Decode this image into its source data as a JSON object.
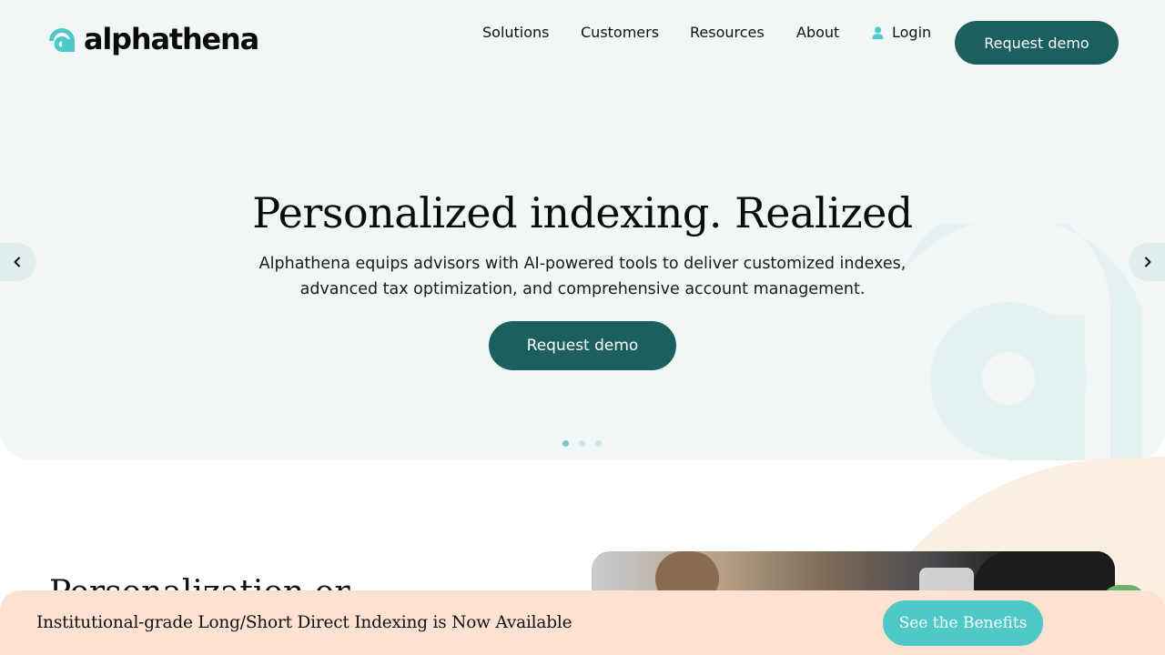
{
  "brand": {
    "name": "alphathena",
    "accent": "#1c5f5f",
    "logo_color": "#4ec9c7"
  },
  "nav": {
    "items": [
      {
        "label": "Solutions"
      },
      {
        "label": "Customers"
      },
      {
        "label": "Resources"
      },
      {
        "label": "About"
      }
    ],
    "login_label": "Login",
    "cta_label": "Request demo"
  },
  "hero": {
    "title": "Personalized indexing. Realized",
    "subtitle_line1": "Alphathena equips advisors with AI-powered tools to deliver customized indexes,",
    "subtitle_line2": "advanced tax optimization, and comprehensive account management.",
    "cta_label": "Request demo",
    "carousel": {
      "slides": 3,
      "active": 1
    }
  },
  "section2": {
    "title": "Personalization or"
  },
  "banner": {
    "text": "Institutional-grade Long/Short Direct Indexing is Now Available",
    "cta_label": "See the Benefits",
    "background": "#fde1d1",
    "button_color": "#4ec9c7"
  },
  "icons": [
    "logo-mark-icon",
    "user-icon",
    "chevron-left-icon",
    "chevron-right-icon",
    "chat-icon"
  ]
}
